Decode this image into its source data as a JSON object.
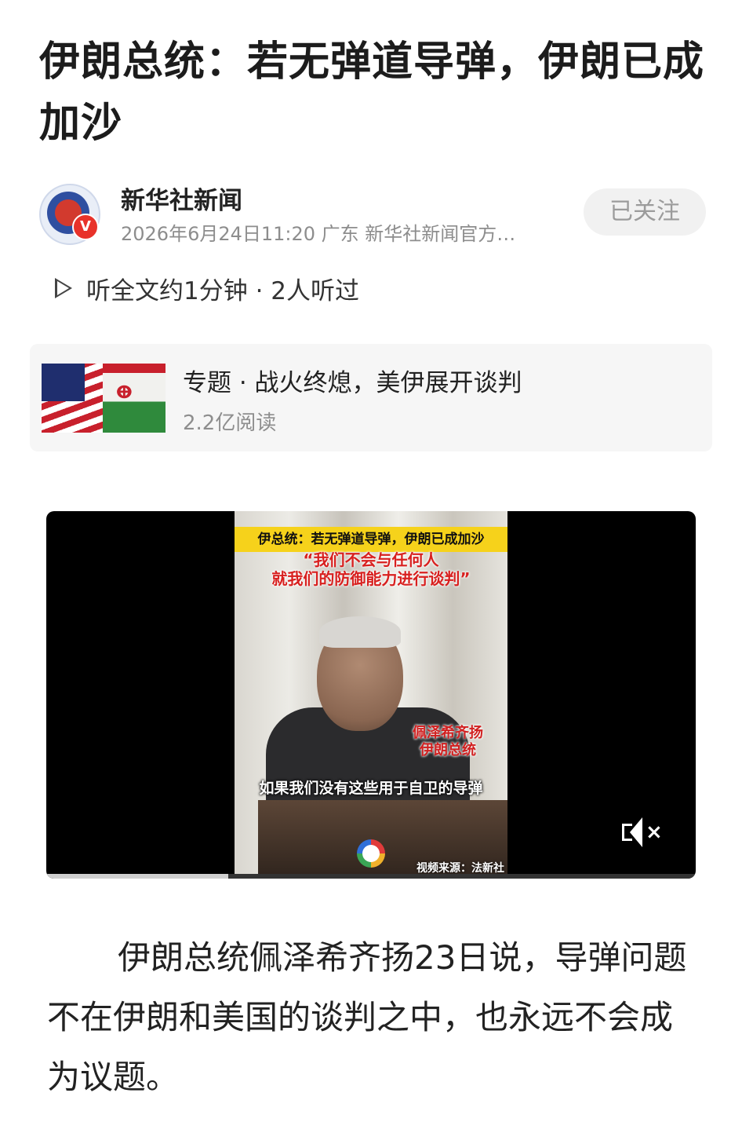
{
  "article": {
    "title": "伊朗总统：若无弹道导弹，伊朗已成加沙"
  },
  "author": {
    "name": "新华社新闻",
    "meta": "2026年6月24日11:20 广东 新华社新闻官方…",
    "avatar_badge": "V",
    "follow_label": "已关注"
  },
  "listen": {
    "label": "听全文约1分钟 · 2人听过"
  },
  "topic": {
    "title": "专题 · 战火终熄，美伊展开谈判",
    "reads": "2.2亿阅读"
  },
  "video": {
    "caption_top": "伊总统：若无弹道导弹，伊朗已成加沙",
    "quote_line1": "“我们不会与任何人",
    "quote_line2": "就我们的防御能力进行谈判”",
    "name_line1": "佩泽希齐扬",
    "name_line2": "伊朗总统",
    "subtitle": "如果我们没有这些用于自卫的导弹",
    "source": "视频来源：法新社",
    "muted": true,
    "progress_fraction": 0.28
  },
  "body": {
    "paragraph": "伊朗总统佩泽希齐扬23日说，导弹问题不在伊朗和美国的谈判之中，也永远不会成为议题。"
  },
  "icons": {
    "play": "play-icon",
    "mute": "mute-icon"
  }
}
